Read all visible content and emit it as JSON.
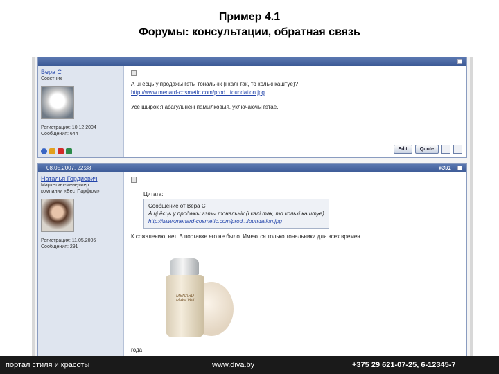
{
  "slide": {
    "title_line1": "Пример 4.1",
    "title_line2": "Форумы: консультации, обратная связь"
  },
  "post1": {
    "username": "Вера С",
    "user_title": "Советник",
    "registered": "Регистрация: 10.12.2004",
    "messages": "Сообщения: 644",
    "text_line1": "А ці ёсць у продажы гэты тональнік (і калі так, то колькі каштуе)?",
    "link": "http://www.menard-cosmetic.com/prod...foundation.jpg",
    "signature": "Усе шырок я абагульнені памылковыя, уключаючы гэтае.",
    "edit_label": "Edit",
    "quote_label": "Quote"
  },
  "post2": {
    "date": "08.05.2007, 22:38",
    "number": "#391",
    "username": "Наталья Гордиевич",
    "user_title_1": "Маркетинг-менеджер",
    "user_title_2": "компании «БестПарфюм»",
    "registered": "Регистрация: 11.05.2006",
    "messages": "Сообщения: 291",
    "quote_header": "Цитата:",
    "quote_author": "Сообщение от Вера С",
    "quote_text": "А ці ёсць у продажы гэты тональнік (і калі так, то колькі каштуе)?",
    "quote_link": "http://www.menard-cosmetic.com/prod...foundation.jpg",
    "reply_text": "К сожалению, нет. В поставке его не было. Имеются только тональники для всех времен",
    "after_image": "года",
    "product_brand": "MENARD",
    "product_name": "Make Veil"
  },
  "footer": {
    "left": "портал стиля и красоты",
    "mid": "www.diva.by",
    "right": "+375 29 621-07-25, 6-12345-7"
  }
}
